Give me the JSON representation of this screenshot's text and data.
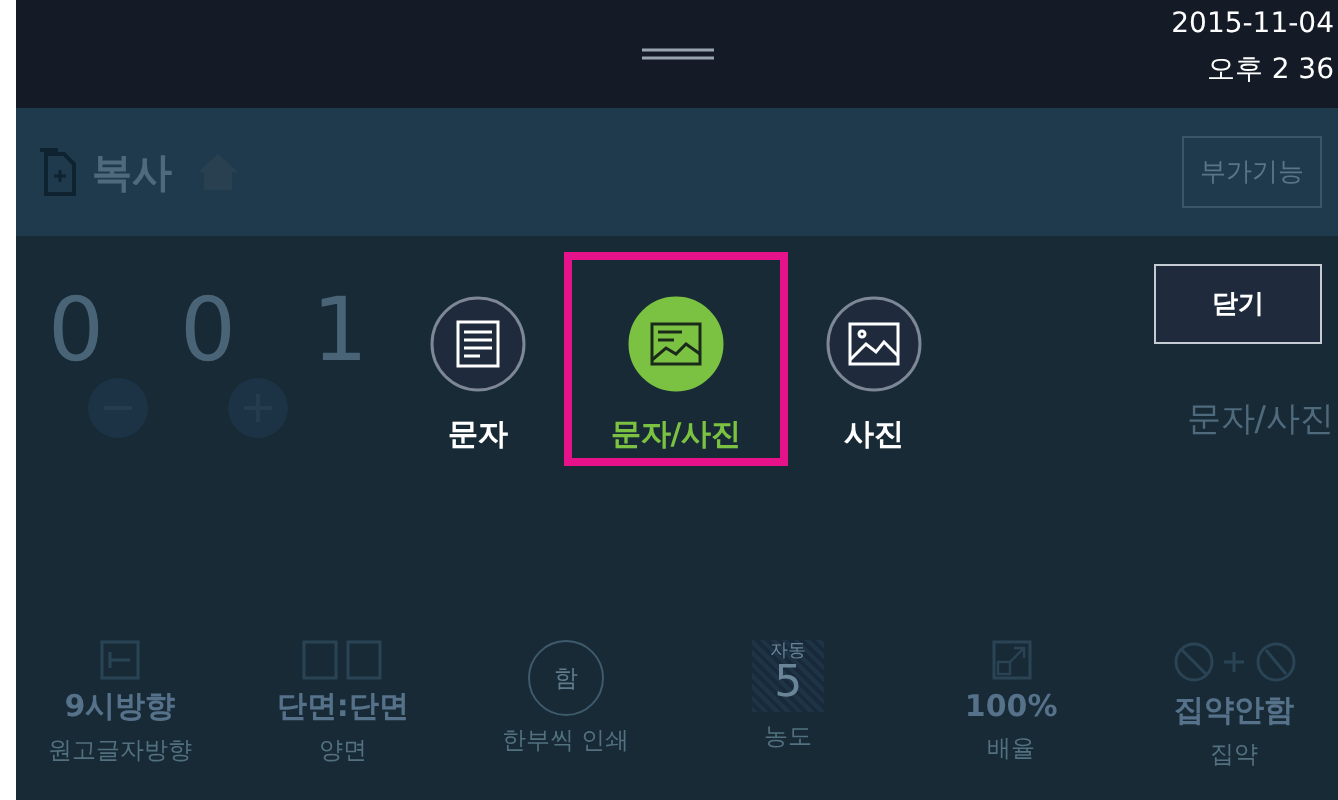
{
  "status_bar": {
    "date": "2015-11-04",
    "time": "오후 2 36"
  },
  "header": {
    "title": "복사",
    "extra_button": "부가기능"
  },
  "counter": {
    "digits": [
      "0",
      "0",
      "1"
    ]
  },
  "background_setting": "문자/사진",
  "popup": {
    "close_button": "닫기",
    "options": [
      {
        "label": "문자",
        "kind": "text",
        "selected": false
      },
      {
        "label": "문자/사진",
        "kind": "mixed",
        "selected": true
      },
      {
        "label": "사진",
        "kind": "photo",
        "selected": false
      }
    ]
  },
  "bottom_settings": [
    {
      "kind": "orientation",
      "value": "9시방향",
      "label": "원고글자방향"
    },
    {
      "kind": "duplex",
      "value": "단면:단면",
      "label": "양면"
    },
    {
      "kind": "collate",
      "badge": "함",
      "label": "한부씩 인쇄"
    },
    {
      "kind": "density",
      "badge": "자동",
      "value": "5",
      "label": "농도"
    },
    {
      "kind": "zoom",
      "value": "100%",
      "label": "배율"
    },
    {
      "kind": "nup",
      "value": "집약안함",
      "label": "집약"
    }
  ]
}
